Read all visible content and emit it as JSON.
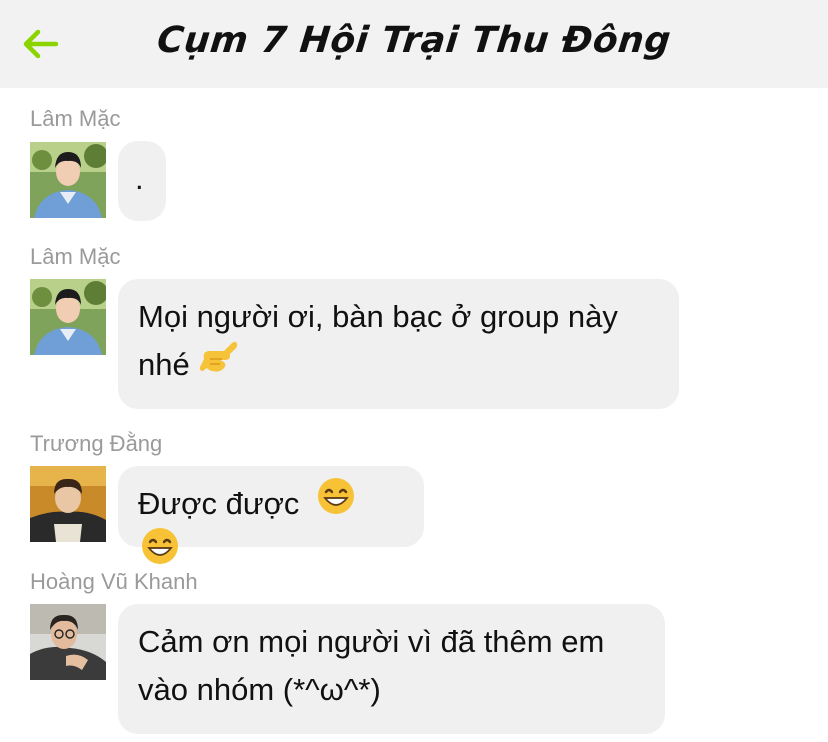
{
  "header": {
    "title": "Cụm 7 Hội Trại Thu Đông",
    "back_icon": "back-arrow-icon",
    "accent_color": "#8cd400",
    "background": "#f2f2f2"
  },
  "messages": [
    {
      "sender": "Lâm Mặc",
      "text": ".",
      "emojis": []
    },
    {
      "sender": "Lâm Mặc",
      "text_line1": "Mọi người ơi, bàn bạc ở group này",
      "text_line2": "nhé",
      "emojis": [
        "call-me-hand-emoji"
      ]
    },
    {
      "sender": "Trương Đằng",
      "text": "Được được",
      "emojis": [
        "grinning-face-emoji",
        "grinning-face-emoji"
      ]
    },
    {
      "sender": "Hoàng Vũ Khanh",
      "text_line1": "Cảm ơn mọi người vì đã thêm em",
      "text_line2": "vào nhóm (*^ω^*)",
      "emojis": []
    }
  ],
  "colors": {
    "bubble": "#f0f0f0",
    "sender_name": "#9a9a9a",
    "text": "#111111"
  }
}
